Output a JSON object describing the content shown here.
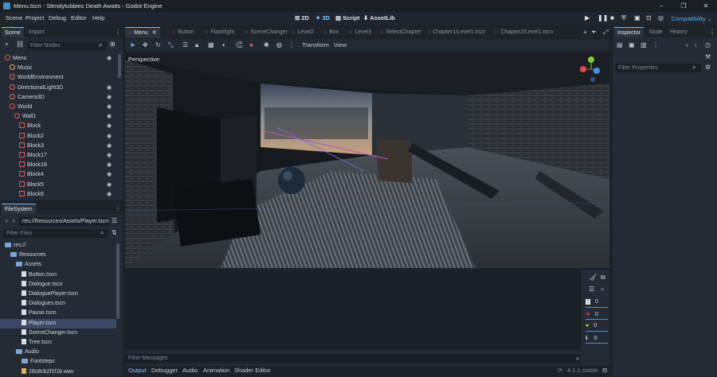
{
  "window": {
    "title": "Menu.tscn - Slendytubbies Death Awaits - Godot Engine",
    "minimize": "–",
    "maximize": "❐",
    "close": "✕"
  },
  "menu": [
    "Scene",
    "Project",
    "Debug",
    "Editor",
    "Help"
  ],
  "modes": [
    "2D",
    "3D",
    "Script",
    "AssetLib"
  ],
  "renderer": "Compatibility",
  "scene_dock": {
    "tabs": [
      "Scene",
      "Import"
    ],
    "filter_placeholder": "Filter Nodes",
    "nodes": [
      {
        "label": "Menu",
        "depth": 0,
        "color": "#e05a5a"
      },
      {
        "label": "Music",
        "depth": 1,
        "color": "#e0b060"
      },
      {
        "label": "WorldEnvironment",
        "depth": 1,
        "color": "#e07070"
      },
      {
        "label": "DirectionalLight3D",
        "depth": 1,
        "color": "#e07070"
      },
      {
        "label": "Camera3D",
        "depth": 1,
        "color": "#e07070"
      },
      {
        "label": "World",
        "depth": 1,
        "color": "#e05a5a"
      },
      {
        "label": "Wall1",
        "depth": 2,
        "color": "#e05a5a"
      },
      {
        "label": "Block",
        "depth": 3,
        "color": "#e05a5a"
      },
      {
        "label": "Block2",
        "depth": 3,
        "color": "#e05a5a"
      },
      {
        "label": "Block3",
        "depth": 3,
        "color": "#e05a5a"
      },
      {
        "label": "Block17",
        "depth": 3,
        "color": "#e05a5a"
      },
      {
        "label": "Block18",
        "depth": 3,
        "color": "#e05a5a"
      },
      {
        "label": "Block4",
        "depth": 3,
        "color": "#e05a5a"
      },
      {
        "label": "Block5",
        "depth": 3,
        "color": "#e05a5a"
      },
      {
        "label": "Block6",
        "depth": 3,
        "color": "#e05a5a"
      }
    ]
  },
  "filesystem": {
    "tab": "FileSystem",
    "path": "res://Resources/Assets/Player.tscn",
    "filter_placeholder": "Filter Files",
    "items": [
      {
        "label": "res://",
        "depth": 0,
        "kind": "folder"
      },
      {
        "label": "Resources",
        "depth": 1,
        "kind": "folder"
      },
      {
        "label": "Assets",
        "depth": 2,
        "kind": "folder"
      },
      {
        "label": "Button.tscn",
        "depth": 3,
        "kind": "file"
      },
      {
        "label": "Dialogue.tscn",
        "depth": 3,
        "kind": "file"
      },
      {
        "label": "DialoguePlayer.tscn",
        "depth": 3,
        "kind": "file"
      },
      {
        "label": "Dialogues.tscn",
        "depth": 3,
        "kind": "file"
      },
      {
        "label": "Pause.tscn",
        "depth": 3,
        "kind": "file"
      },
      {
        "label": "Player.tscn",
        "depth": 3,
        "kind": "file",
        "selected": true
      },
      {
        "label": "SceneChanger.tscn",
        "depth": 3,
        "kind": "file"
      },
      {
        "label": "Tree.tscn",
        "depth": 3,
        "kind": "file"
      },
      {
        "label": "Audio",
        "depth": 2,
        "kind": "folder"
      },
      {
        "label": "Footsteps",
        "depth": 3,
        "kind": "folder"
      },
      {
        "label": "28c8cb2f1f1b.wav",
        "depth": 3,
        "kind": "audio"
      }
    ]
  },
  "scene_tabs": [
    "Menu",
    "Button",
    "Flashlight",
    "SceneChanger",
    "Level2",
    "Box",
    "Level3",
    "SelectChapter",
    "Chapter1/Level1.tscn",
    "Chapter2/Level1.tscn"
  ],
  "viewport_toolbar": {
    "transform_menu": "Transform",
    "view_menu": "View"
  },
  "viewport": {
    "label": "Perspective"
  },
  "inspector": {
    "tabs": [
      "Inspector",
      "Node",
      "History"
    ],
    "filter_placeholder": "Filter Properties"
  },
  "output": {
    "filter_placeholder": "Filter Messages",
    "counters": [
      "0",
      "0",
      "0",
      "0"
    ],
    "bottom_tabs": [
      "Output",
      "Debugger",
      "Audio",
      "Animation",
      "Shader Editor"
    ],
    "version": "4.1.1.stable"
  }
}
